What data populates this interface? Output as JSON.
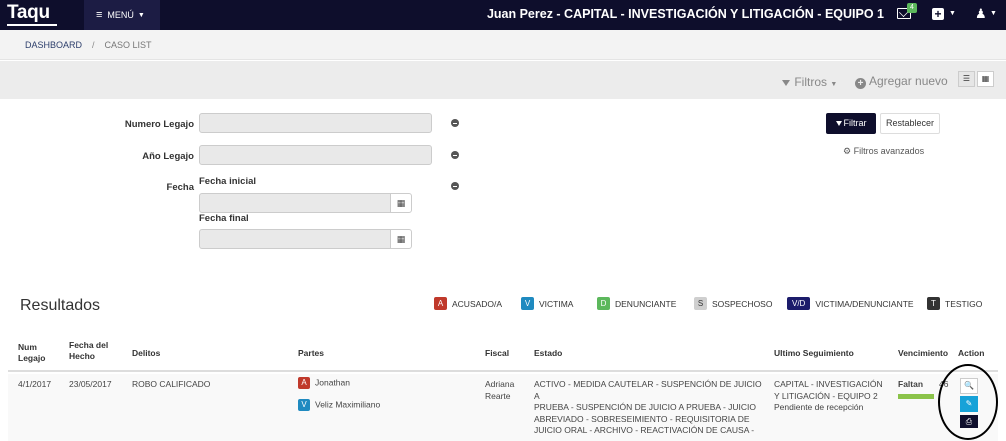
{
  "navbar": {
    "brand": "Taqu",
    "menu_label": "MENÚ",
    "user_title": "Juan Perez - CAPITAL - INVESTIGACIÓN Y LITIGACIÓN - EQUIPO 1",
    "mail_badge": "4"
  },
  "breadcrumb": {
    "items": [
      "DASHBOARD",
      "CASO LIST"
    ],
    "separator": "/"
  },
  "toolbar": {
    "filtros_label": "Filtros",
    "agregar_label": "Agregar nuevo"
  },
  "filters": {
    "numero_legajo_label": "Numero Legajo",
    "anio_legajo_label": "Año Legajo",
    "fecha_label": "Fecha",
    "fecha_inicial_label": "Fecha inicial",
    "fecha_final_label": "Fecha final",
    "filtrar_label": "Filtrar",
    "restablecer_label": "Restablecer",
    "avanzados_label": "Filtros avanzados"
  },
  "results": {
    "title": "Resultados",
    "legend": [
      {
        "code": "A",
        "label": "ACUSADO/A",
        "color": "#c0392b"
      },
      {
        "code": "V",
        "label": "VICTIMA",
        "color": "#1f8ac0"
      },
      {
        "code": "D",
        "label": "DENUNCIANTE",
        "color": "#5cb85c"
      },
      {
        "code": "S",
        "label": "SOSPECHOSO",
        "color": "#cfcfcf"
      },
      {
        "code": "V/D",
        "label": "VICTIMA/DENUNCIANTE",
        "color": "#1c1c6b"
      },
      {
        "code": "T",
        "label": "TESTIGO",
        "color": "#333333"
      }
    ]
  },
  "table": {
    "headers": {
      "num_legajo_1": "Num",
      "num_legajo_2": "Legajo",
      "fecha_1": "Fecha del",
      "fecha_2": "Hecho",
      "delitos": "Delitos",
      "partes": "Partes",
      "fiscal": "Fiscal",
      "estado": "Estado",
      "ultimo": "Ultimo Seguimiento",
      "vencimiento": "Vencimiento",
      "action": "Action"
    },
    "rows": [
      {
        "num_legajo": "4/1/2017",
        "fecha": "23/05/2017",
        "delitos": "ROBO CALIFICADO",
        "partes": [
          {
            "code": "A",
            "name": "Jonathan",
            "color": "#c0392b"
          },
          {
            "code": "V",
            "name": "Veliz Maximiliano",
            "color": "#1f8ac0"
          }
        ],
        "fiscal_1": "Adriana",
        "fiscal_2": "Rearte",
        "estado_lines": [
          "ACTIVO - MEDIDA CAUTELAR - SUSPENCIÓN DE JUICIO A",
          "PRUEBA - SUSPENCIÓN DE JUICIO A PRUEBA - JUICIO",
          "ABREVIADO - SOBRESEIMIENTO - REQUISITORIA DE",
          "JUICIO ORAL - ARCHIVO - REACTIVACIÓN DE CAUSA -"
        ],
        "ultimo_lines": [
          "CAPITAL - INVESTIGACIÓN",
          "Y LITIGACIÓN - EQUIPO 2",
          "Pendiente de recepción"
        ],
        "vencimiento_label": "Faltan",
        "vencimiento_num": "46",
        "vencimiento_progress": 1.0
      }
    ]
  },
  "colors": {
    "navbar": "#0e0e2c",
    "accent_edit": "#17a2d8",
    "progress": "#8bc34a"
  }
}
